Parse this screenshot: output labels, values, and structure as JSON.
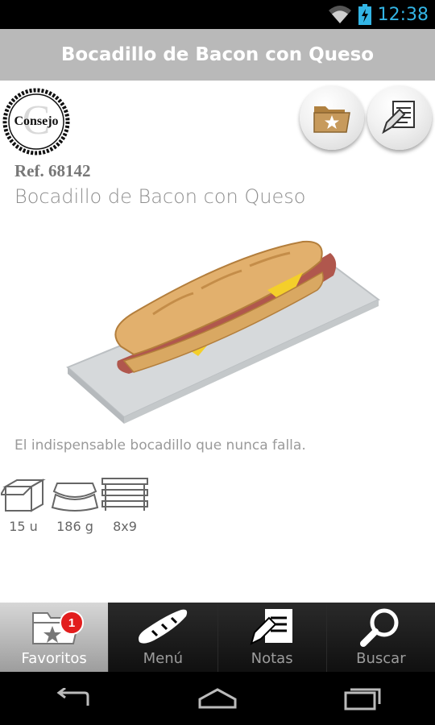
{
  "status_bar": {
    "time": "12:38",
    "icons": [
      "wifi-icon",
      "battery-icon"
    ]
  },
  "title_bar": {
    "title": "Bocadillo de Bacon con Queso"
  },
  "product": {
    "consejo_logo": "Consejo",
    "ref": "Ref. 68142",
    "name": "Bocadillo de Bacon con Queso",
    "description": "El indispensable bocadillo que nunca falla.",
    "specs": [
      {
        "icon": "box-icon",
        "value": "15 u"
      },
      {
        "icon": "weight-icon",
        "value": "186 g"
      },
      {
        "icon": "tray-icon",
        "value": "8x9"
      }
    ]
  },
  "actions": {
    "favorite_icon": "folder-star-icon",
    "notes_icon": "notes-pencil-icon"
  },
  "tabs": [
    {
      "label": "Favoritos",
      "icon": "folder-star-icon",
      "badge": "1",
      "active": true
    },
    {
      "label": "Menú",
      "icon": "bread-icon"
    },
    {
      "label": "Notas",
      "icon": "notes-icon"
    },
    {
      "label": "Buscar",
      "icon": "search-icon"
    }
  ],
  "colors": {
    "clock": "#33b5e5",
    "title_bar": "#b9b9b9",
    "folder": "#c79a5c",
    "badge": "#e21d1d"
  }
}
